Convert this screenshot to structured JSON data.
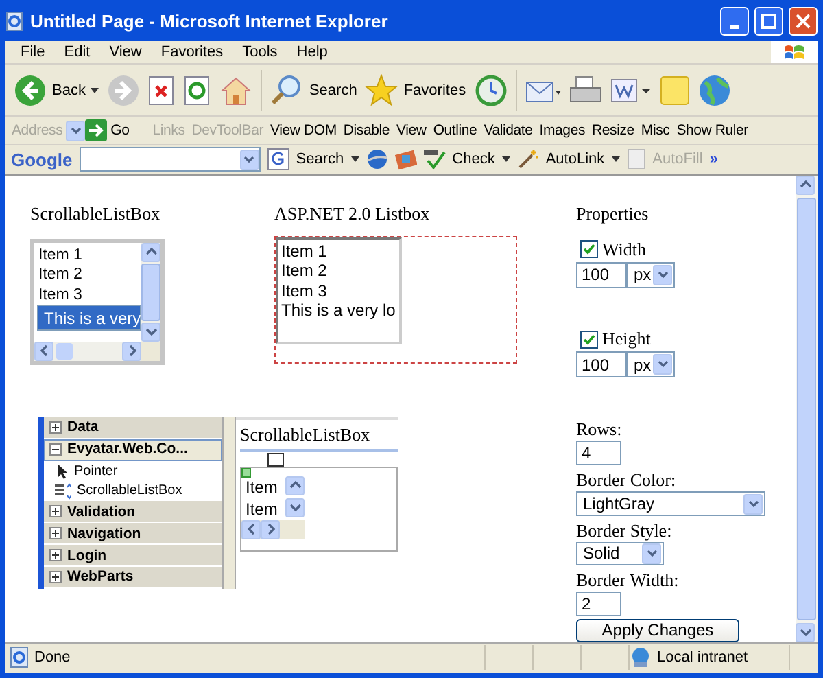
{
  "window": {
    "title": "Untitled Page - Microsoft Internet Explorer"
  },
  "menu": [
    "File",
    "Edit",
    "View",
    "Favorites",
    "Tools",
    "Help"
  ],
  "toolbar": {
    "back": "Back",
    "search": "Search",
    "favorites": "Favorites"
  },
  "links_bar": {
    "address": "Address",
    "go": "Go",
    "links": "Links",
    "items": [
      {
        "label": "DevToolBar",
        "disabled": true
      },
      {
        "label": "View DOM",
        "disabled": false
      },
      {
        "label": "Disable",
        "disabled": false
      },
      {
        "label": "View",
        "disabled": false
      },
      {
        "label": "Outline",
        "disabled": false
      },
      {
        "label": "Validate",
        "disabled": false
      },
      {
        "label": "Images",
        "disabled": false
      },
      {
        "label": "Resize",
        "disabled": false
      },
      {
        "label": "Misc",
        "disabled": false
      },
      {
        "label": "Show Ruler",
        "disabled": false
      }
    ]
  },
  "google_bar": {
    "logo": "Google",
    "search": "Search",
    "check": "Check",
    "autolink": "AutoLink",
    "autofill": {
      "label": "AutoFill",
      "disabled": true
    },
    "more": "»"
  },
  "scrollable_listbox": {
    "heading": "ScrollableListBox",
    "items": [
      {
        "label": "Item 1",
        "selected": false
      },
      {
        "label": "Item 2",
        "selected": false
      },
      {
        "label": "Item 3",
        "selected": false
      },
      {
        "label": "This is a very",
        "selected": true
      }
    ]
  },
  "aspnet_listbox": {
    "heading": "ASP.NET 2.0 Listbox",
    "items": [
      "Item 1",
      "Item 2",
      "Item 3",
      "This is a very lo"
    ]
  },
  "designer": {
    "toolbox": [
      {
        "label": "Data",
        "kind": "category",
        "expanded": false
      },
      {
        "label": "Evyatar.Web.Co...",
        "kind": "category",
        "expanded": true
      },
      {
        "label": "Pointer",
        "kind": "pointer"
      },
      {
        "label": "ScrollableListBox",
        "kind": "control"
      },
      {
        "label": "Validation",
        "kind": "category",
        "expanded": false
      },
      {
        "label": "Navigation",
        "kind": "category",
        "expanded": false
      },
      {
        "label": "Login",
        "kind": "category",
        "expanded": false
      },
      {
        "label": "WebParts",
        "kind": "category",
        "expanded": false
      }
    ],
    "heading": "ScrollableListBox",
    "items": [
      "Item",
      "Item"
    ]
  },
  "properties": {
    "heading": "Properties",
    "width": {
      "label": "Width",
      "checked": true,
      "value": "100",
      "unit": "px"
    },
    "height": {
      "label": "Height",
      "checked": true,
      "value": "100",
      "unit": "px"
    },
    "rows": {
      "label": "Rows:",
      "value": "4"
    },
    "border_color": {
      "label": "Border Color:",
      "value": "LightGray"
    },
    "border_style": {
      "label": "Border Style:",
      "value": "Solid"
    },
    "border_width": {
      "label": "Border Width:",
      "value": "2"
    },
    "apply": "Apply Changes"
  },
  "status_bar": {
    "text": "Done",
    "zone": "Local intranet"
  }
}
